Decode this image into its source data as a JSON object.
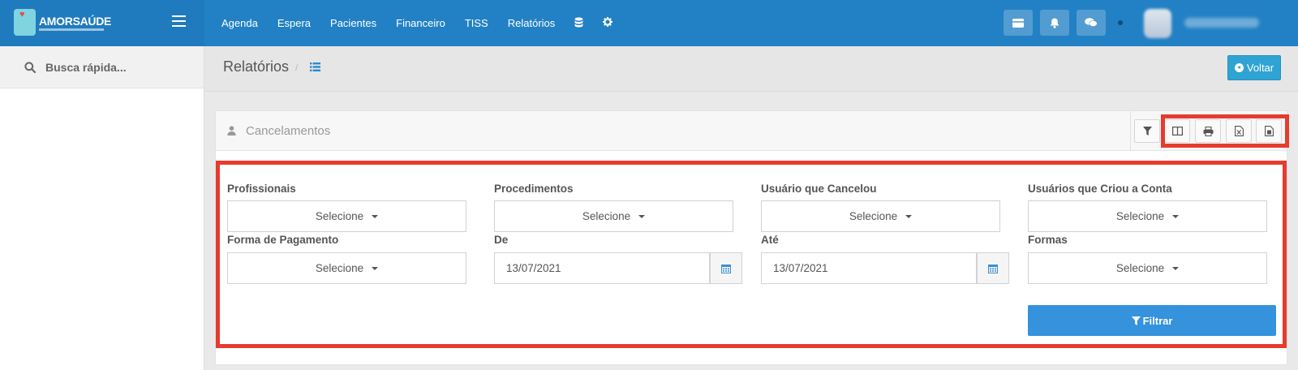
{
  "brand": {
    "name": "AMORSAÚDE"
  },
  "nav": {
    "items": [
      "Agenda",
      "Espera",
      "Pacientes",
      "Financeiro",
      "TISS",
      "Relatórios"
    ]
  },
  "sidebar": {
    "search_placeholder": "Busca rápida..."
  },
  "page": {
    "title": "Relatórios",
    "breadcrumb_sep": "/",
    "back_label": "Voltar"
  },
  "panel": {
    "title": "Cancelamentos"
  },
  "filters": {
    "profissionais_label": "Profissionais",
    "procedimentos_label": "Procedimentos",
    "usuario_cancelou_label": "Usuário que Cancelou",
    "usuarios_criou_label": "Usuários que Criou a Conta",
    "forma_pagamento_label": "Forma de Pagamento",
    "de_label": "De",
    "ate_label": "Até",
    "formas_label": "Formas",
    "select_default": "Selecione",
    "de_value": "13/07/2021",
    "ate_value": "13/07/2021",
    "filter_button": "Filtrar"
  },
  "colors": {
    "topbar": "#2281c4",
    "accent": "#3592dc",
    "highlight": "#e63b2e"
  },
  "icons": [
    "hamburger-icon",
    "database-icon",
    "gear-icon",
    "card-icon",
    "bell-icon",
    "chat-icon",
    "search-icon",
    "list-icon",
    "user-icon",
    "filter-icon",
    "columns-icon",
    "print-icon",
    "excel-icon",
    "pdf-icon",
    "calendar-icon"
  ]
}
